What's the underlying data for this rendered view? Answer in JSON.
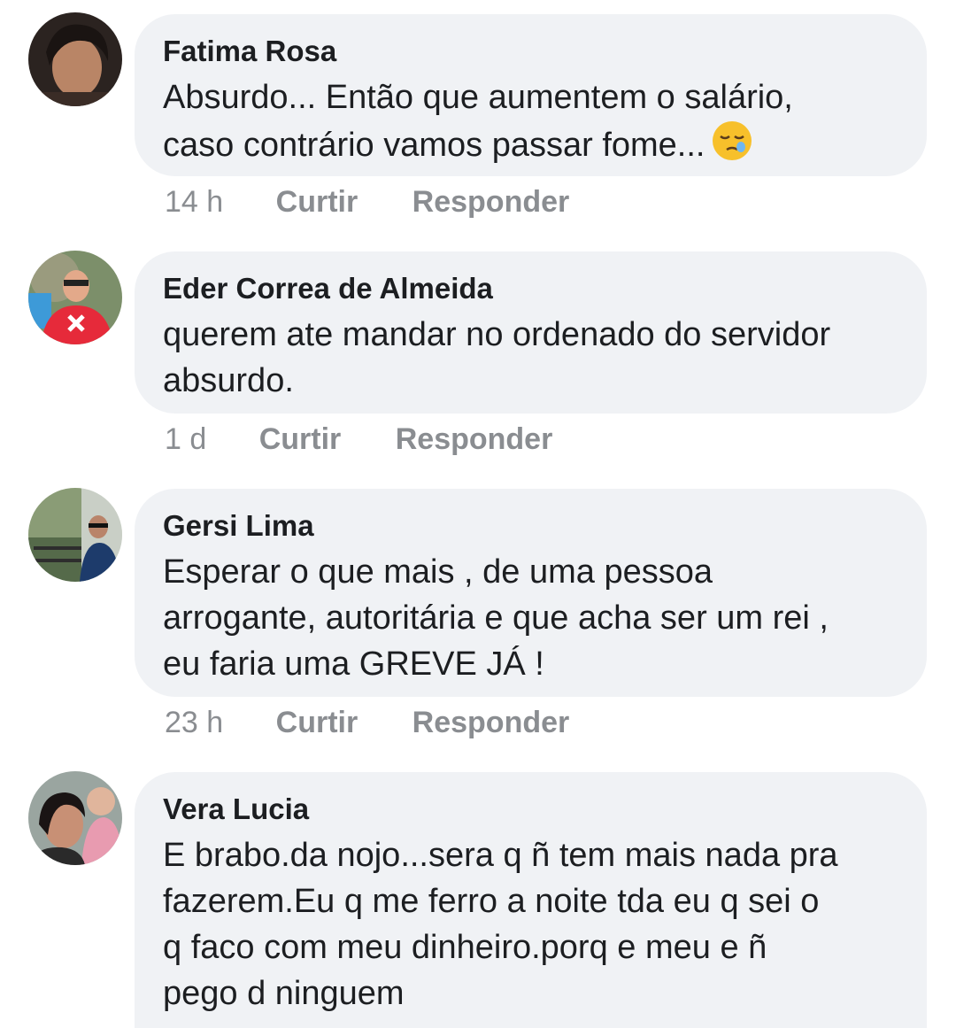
{
  "comments": [
    {
      "author": "Fatima Rosa",
      "text": "Absurdo... Então que aumentem o salário,\ncaso contrário vamos passar fome...",
      "emoji": "sleepy-face",
      "time": "14 h",
      "like_label": "Curtir",
      "reply_label": "Responder"
    },
    {
      "author": "Eder Correa de Almeida",
      "text": "querem ate mandar no ordenado do servidor\nabsurdo.",
      "time": "1 d",
      "like_label": "Curtir",
      "reply_label": "Responder"
    },
    {
      "author": "Gersi Lima",
      "text": "Esperar o que mais , de uma pessoa\narrogante, autoritária e que acha ser um rei ,\neu faria uma GREVE JÁ  !",
      "time": "23 h",
      "like_label": "Curtir",
      "reply_label": "Responder"
    },
    {
      "author": "Vera Lucia",
      "text": "E brabo.da nojo...sera q ñ tem mais nada pra\nfazerem.Eu q me ferro a noite tda eu q sei o\nq faco com meu dinheiro.porq e meu e ñ\npego d ninguem"
    }
  ],
  "colors": {
    "bubble_bg": "#f0f2f5",
    "text": "#1c1e21",
    "meta": "#8a8d91"
  }
}
